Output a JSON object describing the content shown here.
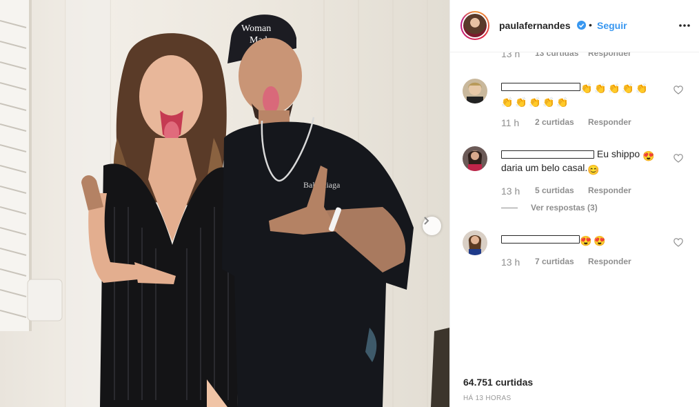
{
  "post": {
    "username": "paulafernandes",
    "follow_label": "Seguir",
    "separator": "•",
    "likes_total": "64.751 curtidas",
    "time_ago": "HÁ 13 HORAS"
  },
  "comments": [
    {
      "time": "13 h",
      "likes": "13 curtidas",
      "reply": "Responder"
    },
    {
      "time": "11 h",
      "likes": "2 curtidas",
      "reply": "Responder",
      "emoji": "clapping-hands"
    },
    {
      "text_line1": "Eu shippo",
      "text_line2": "daria um belo casal.",
      "time": "13 h",
      "likes": "5 curtidas",
      "reply": "Responder",
      "view_replies": "Ver respostas (3)"
    },
    {
      "time": "13 h",
      "likes": "7 curtidas",
      "reply": "Responder",
      "emoji": "heart-eyes"
    }
  ],
  "colors": {
    "link": "#3897f0",
    "muted": "#8e8e8e",
    "text": "#262626",
    "border": "#efefef"
  }
}
